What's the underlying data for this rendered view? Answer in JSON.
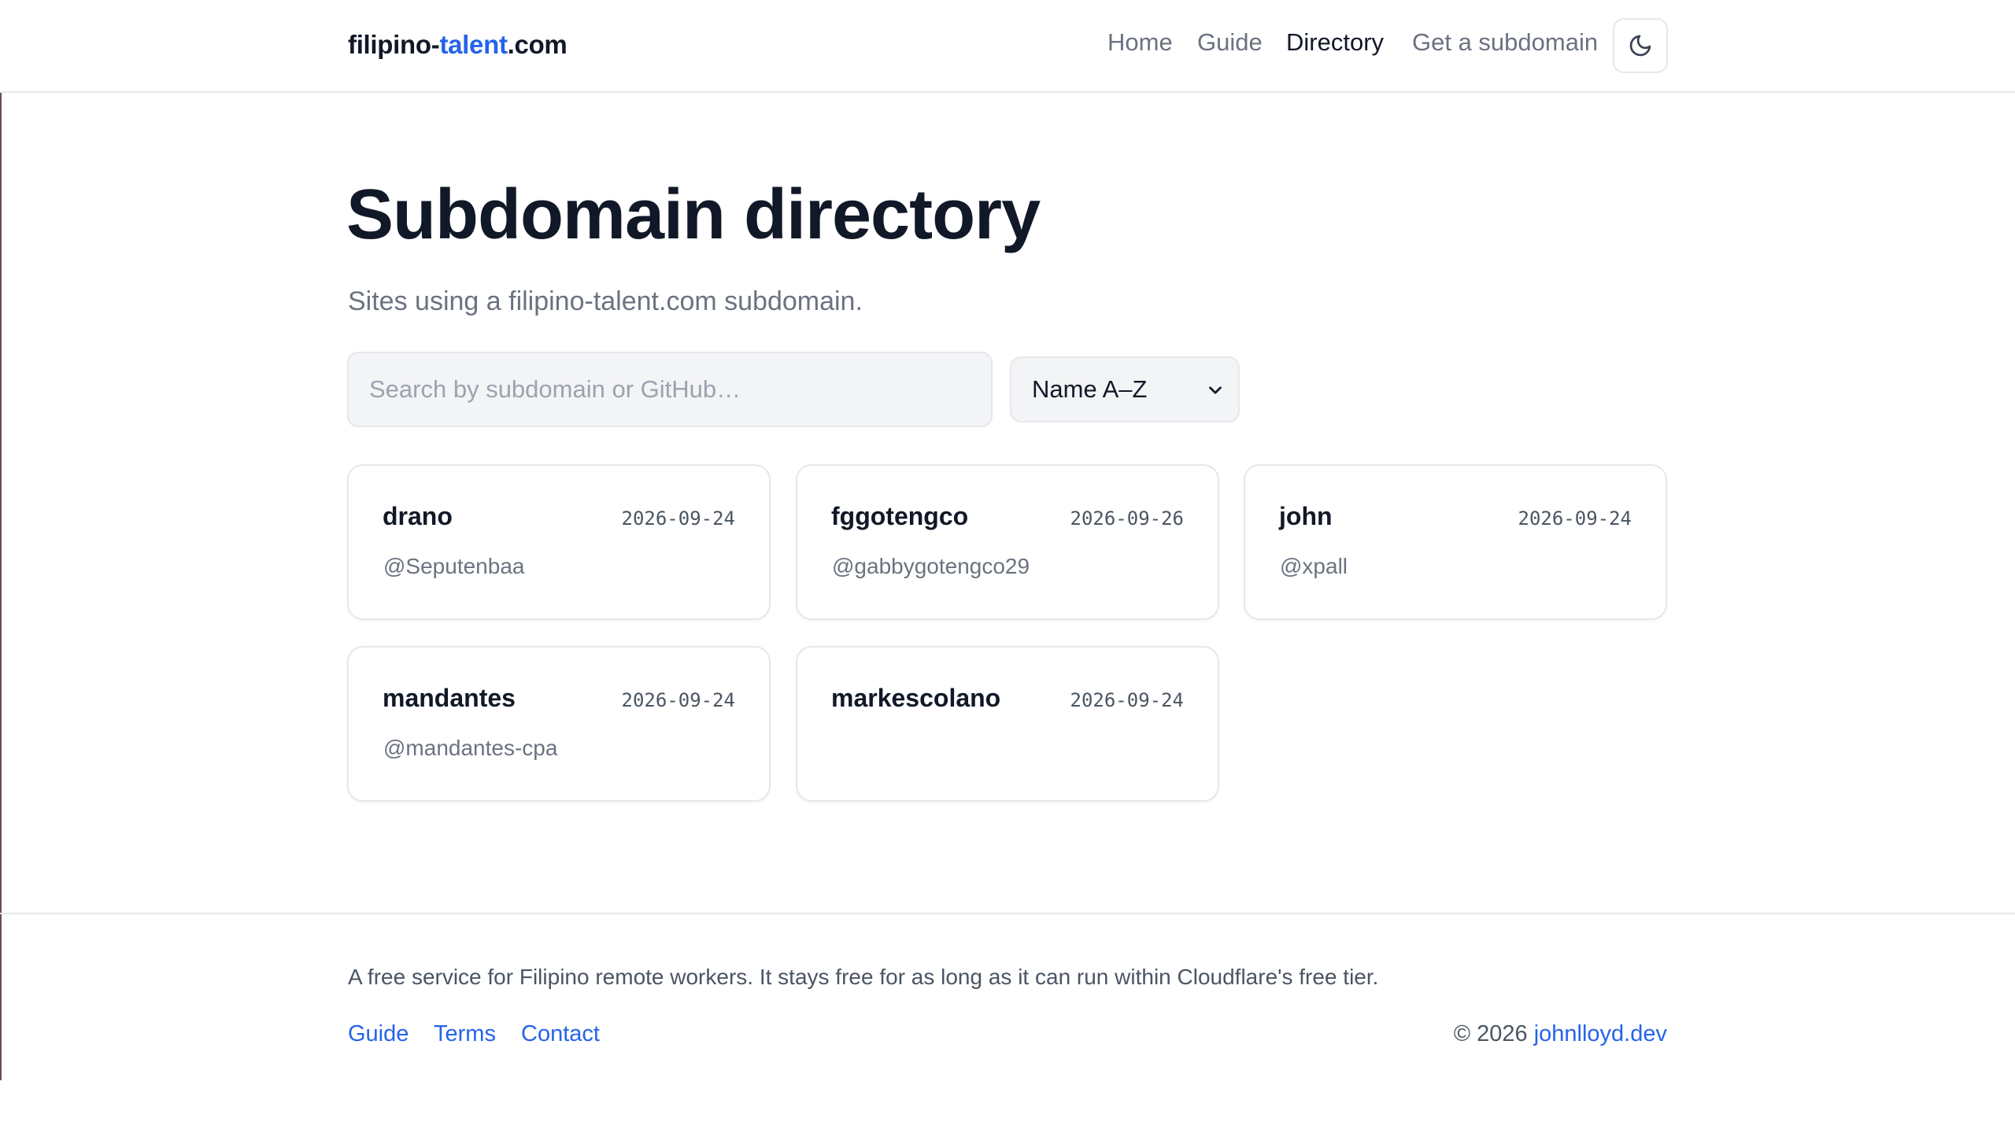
{
  "header": {
    "brand_prefix": "filipino-",
    "brand_accent": "talent",
    "brand_suffix": ".com",
    "nav": [
      {
        "label": "Home"
      },
      {
        "label": "Guide"
      },
      {
        "label": "Directory"
      },
      {
        "label": "Get a subdomain"
      }
    ],
    "theme_toggle_icon": "moon-icon"
  },
  "main": {
    "title": "Subdomain directory",
    "subtitle": "Sites using a filipino-talent.com subdomain.",
    "search_placeholder": "Search by subdomain or GitHub…",
    "search_value": "",
    "sort_selected": "Name A–Z"
  },
  "cards": [
    {
      "name": "drano",
      "date": "2026-09-24",
      "github": "@Seputenbaa"
    },
    {
      "name": "fggotengco",
      "date": "2026-09-26",
      "github": "@gabbygotengco29"
    },
    {
      "name": "john",
      "date": "2026-09-24",
      "github": "@xpall"
    },
    {
      "name": "mandantes",
      "date": "2026-09-24",
      "github": "@mandantes-cpa"
    },
    {
      "name": "markescolano",
      "date": "2026-09-24",
      "github": ""
    }
  ],
  "footer": {
    "text": "A free service for Filipino remote workers. It stays free for as long as it can run within Cloudflare's free tier.",
    "links": [
      {
        "label": "Guide"
      },
      {
        "label": "Terms"
      },
      {
        "label": "Contact"
      }
    ],
    "copyright_prefix": "© 2026 ",
    "copyright_link": "johnlloyd.dev"
  },
  "colors": {
    "accent": "#2563eb",
    "text": "#111827",
    "muted": "#6b7280",
    "border": "#e5e7eb",
    "input_bg": "#f3f4f6"
  }
}
